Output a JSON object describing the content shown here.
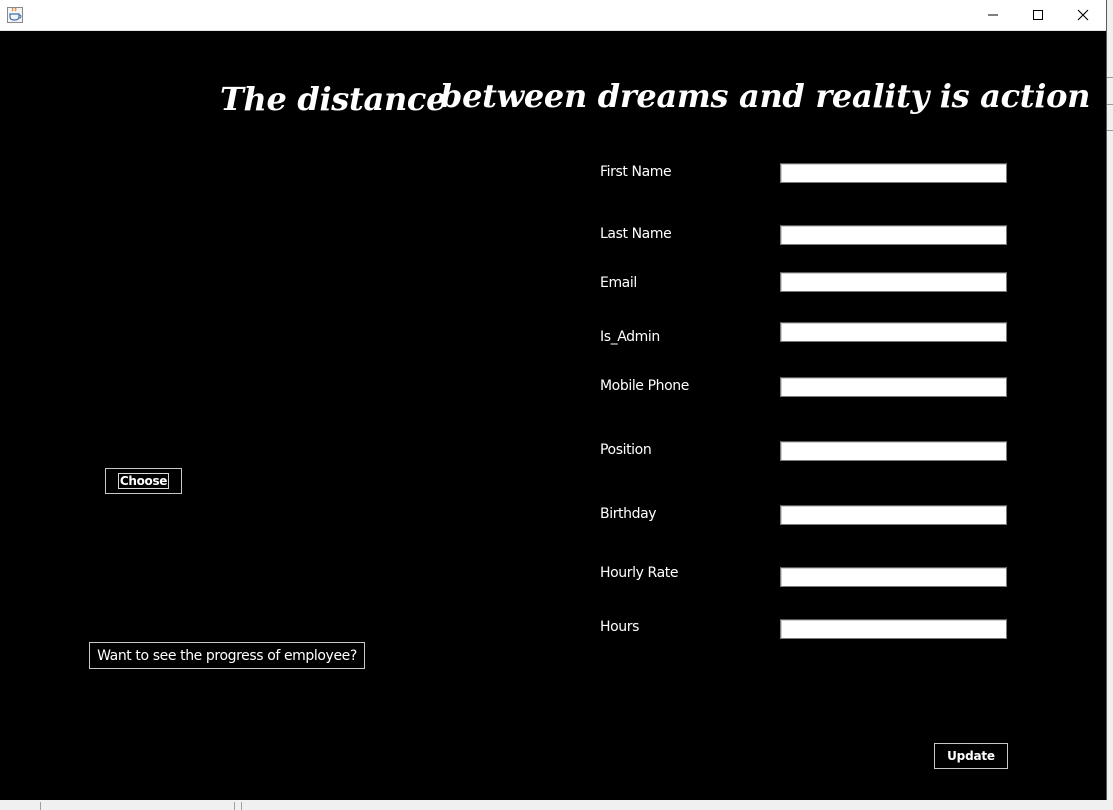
{
  "window": {
    "title": "",
    "app_icon": "java-icon",
    "controls": {
      "minimize": "minimize-icon",
      "maximize": "maximize-icon",
      "close": "close-icon"
    }
  },
  "quote": {
    "part1": "The distance",
    "part2": "between dreams and reality is action"
  },
  "form": {
    "fields": [
      {
        "label": "First Name",
        "value": ""
      },
      {
        "label": "Last Name",
        "value": ""
      },
      {
        "label": "Email",
        "value": ""
      },
      {
        "label": "Is_Admin",
        "value": ""
      },
      {
        "label": "Mobile Phone",
        "value": ""
      },
      {
        "label": "Position",
        "value": ""
      },
      {
        "label": "Birthday",
        "value": ""
      },
      {
        "label": "Hourly Rate",
        "value": ""
      },
      {
        "label": "Hours",
        "value": ""
      }
    ]
  },
  "buttons": {
    "choose": "Choose",
    "progress": "Want to see the progress of employee?",
    "update": "Update"
  },
  "colors": {
    "background": "#000000",
    "text": "#ffffff",
    "titlebar": "#ffffff"
  }
}
